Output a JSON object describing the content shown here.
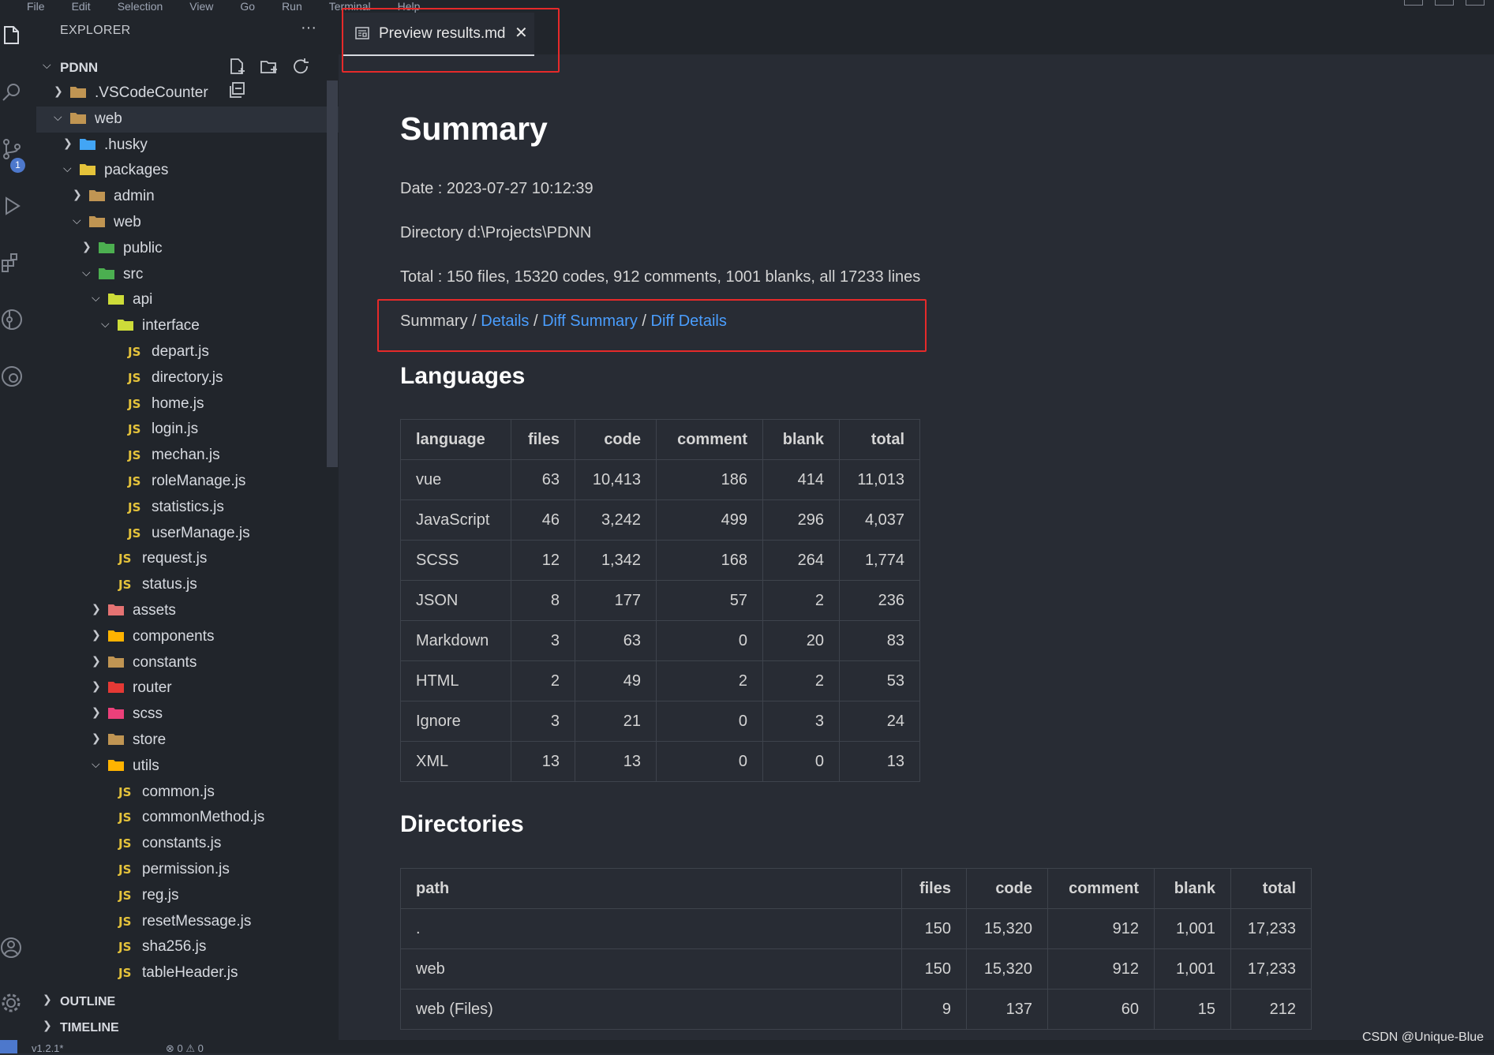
{
  "menubar": {
    "items": [
      "File",
      "Edit",
      "Selection",
      "View",
      "Go",
      "Run",
      "Terminal",
      "Help"
    ]
  },
  "activity": {
    "icons": [
      "explorer-icon",
      "search-icon",
      "source-control-icon",
      "run-debug-icon",
      "extensions-icon",
      "git-graph-icon",
      "git-lens-icon"
    ],
    "badge": "1",
    "bottom": [
      "accounts-icon",
      "settings-gear-icon"
    ]
  },
  "sidebar": {
    "header": "EXPLORER",
    "more": "···",
    "project": "PDNN",
    "tree": [
      {
        "label": ".VSCodeCounter",
        "type": "folder",
        "depth": 0,
        "open": false,
        "icon": "folder"
      },
      {
        "label": "web",
        "type": "folder",
        "depth": 0,
        "open": true,
        "icon": "folder-open",
        "selected": true
      },
      {
        "label": ".husky",
        "type": "folder",
        "depth": 1,
        "open": false,
        "icon": "husky"
      },
      {
        "label": "packages",
        "type": "folder",
        "depth": 1,
        "open": true,
        "icon": "packages"
      },
      {
        "label": "admin",
        "type": "folder",
        "depth": 2,
        "open": false,
        "icon": "folder"
      },
      {
        "label": "web",
        "type": "folder",
        "depth": 2,
        "open": true,
        "icon": "folder-open"
      },
      {
        "label": "public",
        "type": "folder",
        "depth": 3,
        "open": false,
        "icon": "public"
      },
      {
        "label": "src",
        "type": "folder",
        "depth": 3,
        "open": true,
        "icon": "src"
      },
      {
        "label": "api",
        "type": "folder",
        "depth": 4,
        "open": true,
        "icon": "api"
      },
      {
        "label": "interface",
        "type": "folder",
        "depth": 5,
        "open": true,
        "icon": "interface"
      },
      {
        "label": "depart.js",
        "type": "js",
        "depth": 6
      },
      {
        "label": "directory.js",
        "type": "js",
        "depth": 6
      },
      {
        "label": "home.js",
        "type": "js",
        "depth": 6
      },
      {
        "label": "login.js",
        "type": "js",
        "depth": 6
      },
      {
        "label": "mechan.js",
        "type": "js",
        "depth": 6
      },
      {
        "label": "roleManage.js",
        "type": "js",
        "depth": 6
      },
      {
        "label": "statistics.js",
        "type": "js",
        "depth": 6
      },
      {
        "label": "userManage.js",
        "type": "js",
        "depth": 6
      },
      {
        "label": "request.js",
        "type": "js",
        "depth": 5
      },
      {
        "label": "status.js",
        "type": "js",
        "depth": 5
      },
      {
        "label": "assets",
        "type": "folder",
        "depth": 4,
        "open": false,
        "icon": "assets"
      },
      {
        "label": "components",
        "type": "folder",
        "depth": 4,
        "open": false,
        "icon": "components"
      },
      {
        "label": "constants",
        "type": "folder",
        "depth": 4,
        "open": false,
        "icon": "folder"
      },
      {
        "label": "router",
        "type": "folder",
        "depth": 4,
        "open": false,
        "icon": "router"
      },
      {
        "label": "scss",
        "type": "folder",
        "depth": 4,
        "open": false,
        "icon": "scss"
      },
      {
        "label": "store",
        "type": "folder",
        "depth": 4,
        "open": false,
        "icon": "folder"
      },
      {
        "label": "utils",
        "type": "folder",
        "depth": 4,
        "open": true,
        "icon": "utils"
      },
      {
        "label": "common.js",
        "type": "js",
        "depth": 5
      },
      {
        "label": "commonMethod.js",
        "type": "js",
        "depth": 5
      },
      {
        "label": "constants.js",
        "type": "js",
        "depth": 5
      },
      {
        "label": "permission.js",
        "type": "js",
        "depth": 5
      },
      {
        "label": "reg.js",
        "type": "js",
        "depth": 5
      },
      {
        "label": "resetMessage.js",
        "type": "js",
        "depth": 5
      },
      {
        "label": "sha256.js",
        "type": "js",
        "depth": 5
      },
      {
        "label": "tableHeader.js",
        "type": "js",
        "depth": 5
      }
    ],
    "js_badge": "JS",
    "outline": "OUTLINE",
    "timeline": "TIMELINE"
  },
  "tab": {
    "title": "Preview results.md",
    "close": "✕"
  },
  "doc": {
    "title": "Summary",
    "date": "Date : 2023-07-27 10:12:39",
    "directory": "Directory d:\\Projects\\PDNN",
    "total": "Total : 150 files, 15320 codes, 912 comments, 1001 blanks, all 17233 lines",
    "nav": {
      "current": "Summary",
      "sep": " / ",
      "links": [
        "Details",
        "Diff Summary",
        "Diff Details"
      ]
    },
    "languages_heading": "Languages",
    "languages": {
      "headers": [
        "language",
        "files",
        "code",
        "comment",
        "blank",
        "total"
      ],
      "rows": [
        [
          "vue",
          "63",
          "10,413",
          "186",
          "414",
          "11,013"
        ],
        [
          "JavaScript",
          "46",
          "3,242",
          "499",
          "296",
          "4,037"
        ],
        [
          "SCSS",
          "12",
          "1,342",
          "168",
          "264",
          "1,774"
        ],
        [
          "JSON",
          "8",
          "177",
          "57",
          "2",
          "236"
        ],
        [
          "Markdown",
          "3",
          "63",
          "0",
          "20",
          "83"
        ],
        [
          "HTML",
          "2",
          "49",
          "2",
          "2",
          "53"
        ],
        [
          "Ignore",
          "3",
          "21",
          "0",
          "3",
          "24"
        ],
        [
          "XML",
          "13",
          "13",
          "0",
          "0",
          "13"
        ]
      ]
    },
    "directories_heading": "Directories",
    "directories": {
      "headers": [
        "path",
        "files",
        "code",
        "comment",
        "blank",
        "total"
      ],
      "rows": [
        [
          ".",
          "150",
          "15,320",
          "912",
          "1,001",
          "17,233"
        ],
        [
          "web",
          "150",
          "15,320",
          "912",
          "1,001",
          "17,233"
        ],
        [
          "web (Files)",
          "9",
          "137",
          "60",
          "15",
          "212"
        ]
      ]
    }
  },
  "statusbar": {
    "branch": "v1.2.1*",
    "problems": "⊗ 0 ⚠ 0"
  },
  "watermark": "CSDN @Unique-Blue",
  "colors": {
    "accent_link": "#4a9eff",
    "highlight_box": "#e62a2a",
    "js_icon": "#e5c33b",
    "badge": "#4d78cc"
  }
}
